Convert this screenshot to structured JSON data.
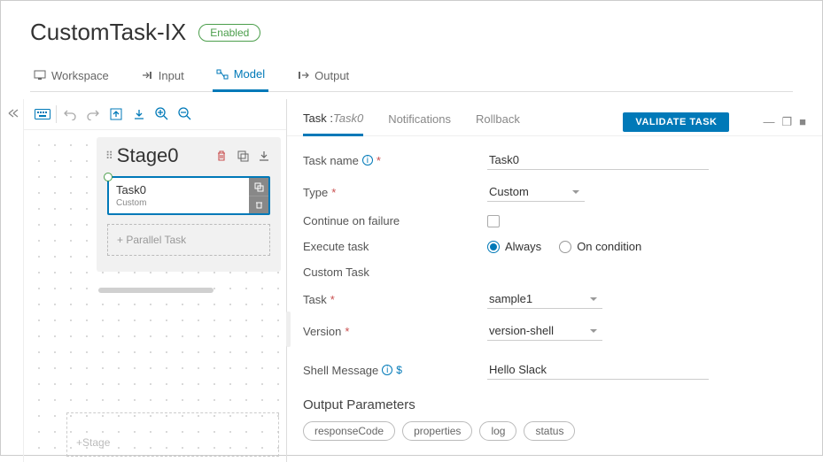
{
  "header": {
    "title": "CustomTask-IX",
    "status": "Enabled"
  },
  "tabs": [
    {
      "label": "Workspace",
      "icon": "workspace"
    },
    {
      "label": "Input",
      "icon": "input"
    },
    {
      "label": "Model",
      "icon": "model"
    },
    {
      "label": "Output",
      "icon": "output"
    }
  ],
  "canvas": {
    "stage": {
      "name": "Stage0",
      "task": {
        "name": "Task0",
        "type": "Custom"
      },
      "parallel_label": "Parallel Task",
      "add_stage_label": "Stage"
    }
  },
  "panel": {
    "tabs": {
      "task_prefix": "Task :",
      "task_value": "Task0",
      "notifications": "Notifications",
      "rollback": "Rollback"
    },
    "validate": "VALIDATE TASK",
    "form": {
      "task_name_label": "Task name",
      "task_name_value": "Task0",
      "type_label": "Type",
      "type_value": "Custom",
      "continue_label": "Continue on failure",
      "continue_checked": false,
      "execute_label": "Execute task",
      "execute_options": {
        "always": "Always",
        "on_condition": "On condition"
      },
      "execute_selected": "always",
      "custom_section": "Custom Task",
      "task_label": "Task",
      "task_value": "sample1",
      "version_label": "Version",
      "version_value": "version-shell",
      "shell_label": "Shell Message",
      "shell_value": "Hello Slack"
    },
    "output": {
      "title": "Output Parameters",
      "params": [
        "responseCode",
        "properties",
        "log",
        "status"
      ]
    }
  }
}
